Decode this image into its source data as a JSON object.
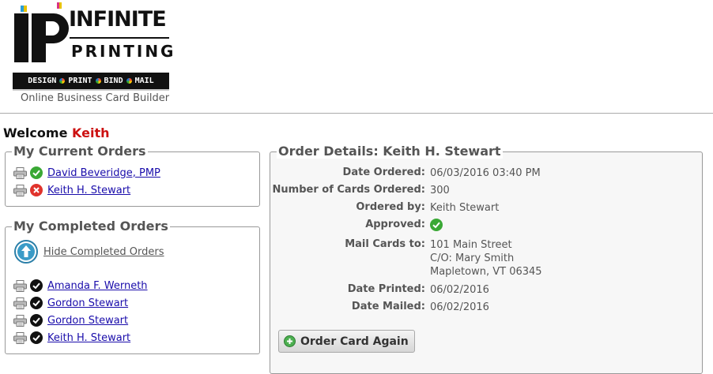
{
  "brand": {
    "logo_letters": "IP",
    "word1": "INFINITE",
    "word2": "PRINTING",
    "tagline": [
      "DESIGN",
      "PRINT",
      "BIND",
      "MAIL"
    ],
    "caption": "Online Business Card Builder"
  },
  "welcome": {
    "prefix": "Welcome",
    "name": "Keith"
  },
  "current_orders": {
    "title": "My Current Orders",
    "items": [
      {
        "name": "David Beveridge, PMP",
        "status": "approved"
      },
      {
        "name": "Keith H. Stewart",
        "status": "not-approved"
      }
    ]
  },
  "completed_orders": {
    "title": "My Completed Orders",
    "hide_label": "Hide Completed Orders",
    "items": [
      {
        "name": "Amanda F. Werneth",
        "status": "completed"
      },
      {
        "name": "Gordon Stewart",
        "status": "completed"
      },
      {
        "name": "Gordon Stewart",
        "status": "completed"
      },
      {
        "name": "Keith H. Stewart",
        "status": "completed"
      }
    ]
  },
  "order_details": {
    "title": "Order Details: Keith H. Stewart",
    "date_ordered_label": "Date Ordered:",
    "date_ordered": "06/03/2016 03:40 PM",
    "cards_label": "Number of Cards Ordered:",
    "cards": "300",
    "ordered_by_label": "Ordered by:",
    "ordered_by": "Keith Stewart",
    "approved_label": "Approved:",
    "approved": true,
    "mail_label": "Mail Cards to:",
    "mail_lines": [
      "101 Main Street",
      "C/O: Mary Smith",
      "Mapletown, VT 06345"
    ],
    "printed_label": "Date Printed:",
    "printed": "06/02/2016",
    "mailed_label": "Date Mailed:",
    "mailed": "06/02/2016",
    "button_label": "Order Card Again"
  },
  "colors": {
    "link": "#1a0dab",
    "welcome_name": "#cc1111",
    "approved_green": "#3aa835",
    "rejected_red": "#e0332c"
  }
}
